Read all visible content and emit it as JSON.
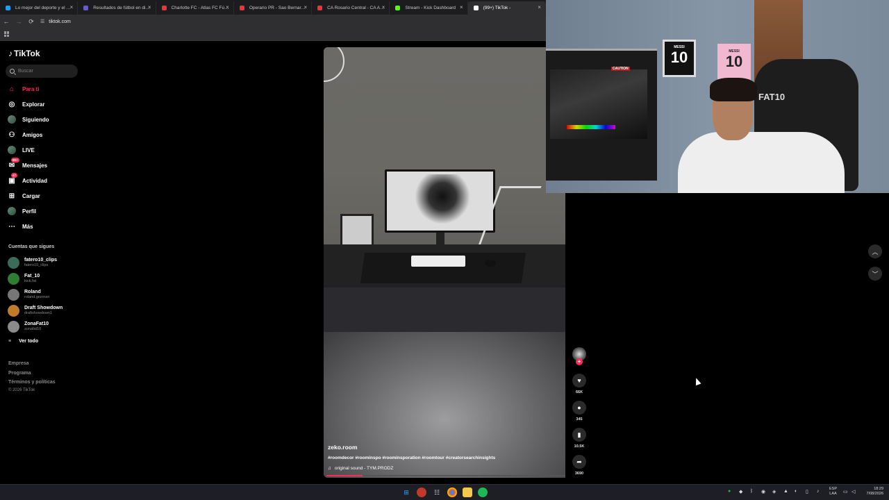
{
  "browser": {
    "tabs": [
      {
        "label": "Lo mejor del deporte y el entre",
        "favicon_color": "#1da1f2"
      },
      {
        "label": "Resultados de fútbol en directo",
        "favicon_color": "#6a5acd"
      },
      {
        "label": "Charlotte FC - Atlas FC Fútbol (",
        "favicon_color": "#e53935"
      },
      {
        "label": "Operario PR - Sao Bernardo SP",
        "favicon_color": "#e53935"
      },
      {
        "label": "CA Rosario Central - CA Aldosi",
        "favicon_color": "#e53935"
      },
      {
        "label": "Stream - Kick Dashboard",
        "favicon_color": "#53fc18"
      },
      {
        "label": "(99+) TikTok -",
        "favicon_color": "#ffffff"
      }
    ],
    "tab_close_glyph": "×",
    "url": "tiktok.com"
  },
  "sidebar": {
    "logo_text": "TikTok",
    "search_placeholder": "Buscar",
    "nav": [
      {
        "label": "Para ti",
        "icon": "home-icon",
        "active": true
      },
      {
        "label": "Explorar",
        "icon": "compass-icon"
      },
      {
        "label": "Siguiendo",
        "icon": "following-avatar-icon"
      },
      {
        "label": "Amigos",
        "icon": "friends-icon"
      },
      {
        "label": "LIVE",
        "icon": "live-icon"
      },
      {
        "label": "Mensajes",
        "icon": "messages-icon",
        "badge": "99+"
      },
      {
        "label": "Actividad",
        "icon": "activity-icon",
        "badge": "47"
      },
      {
        "label": "Cargar",
        "icon": "upload-icon"
      },
      {
        "label": "Perfil",
        "icon": "profile-icon"
      },
      {
        "label": "Más",
        "icon": "more-icon"
      }
    ],
    "following_title": "Cuentas que sigues",
    "accounts": [
      {
        "name": "fatero10_clips",
        "handle": "fatero10_clips",
        "color": "#3d6b5a"
      },
      {
        "name": "Fat_10",
        "handle": "kick.fat",
        "color": "#2e7d32"
      },
      {
        "name": "Roland",
        "handle": "roland.gozman",
        "color": "#777777"
      },
      {
        "name": "Draft Showdown",
        "handle": "draftshowdown1",
        "color": "#c07a2a"
      },
      {
        "name": "ZonaFat10",
        "handle": "zonafat10",
        "color": "#8a8a8a"
      }
    ],
    "see_all": "Ver todo",
    "footer": [
      "Empresa",
      "Programa",
      "Términos y políticas"
    ],
    "copyright": "© 2026 TikTok"
  },
  "video": {
    "username": "zeko.room",
    "caption": "#roomdecor #roominspo #roominsporation #roomtour #creatorsearchinsights",
    "sound": "original sound - TYM.PRODZ",
    "progress_percent": 15,
    "likes": "66K",
    "comments": "345",
    "saves": "10.5K",
    "shares": "3690"
  },
  "webcam": {
    "frame1_name": "MESSI",
    "frame1_number": "10",
    "frame2_name": "MESSI",
    "frame2_number": "10",
    "chair_text": "FAT10",
    "caution_text": "CAUTION"
  },
  "taskbar": {
    "language_top": "ESP",
    "language_bottom": "LAA",
    "time": "18:29",
    "date": "7/08/2026"
  }
}
